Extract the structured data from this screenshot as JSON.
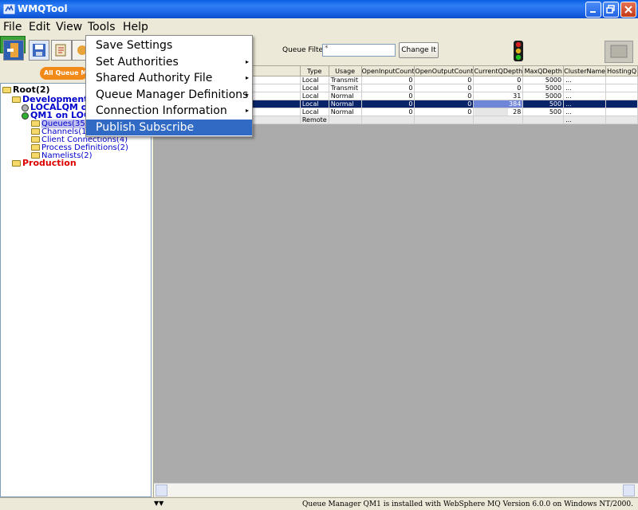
{
  "window": {
    "title": "WMQTool"
  },
  "menubar": {
    "file": "File",
    "edit": "Edit",
    "view": "View",
    "tools": "Tools",
    "help": "Help"
  },
  "tools_menu": {
    "items": [
      {
        "label": "Save Settings",
        "submenu": false
      },
      {
        "label": "Set Authorities",
        "submenu": true
      },
      {
        "label": "Shared Authority File",
        "submenu": true
      },
      {
        "label": "Queue Manager Definitions",
        "submenu": true
      },
      {
        "label": "Connection Information",
        "submenu": true
      },
      {
        "label": "Publish Subscribe",
        "submenu": false,
        "highlighted": true
      }
    ]
  },
  "toolbar": {
    "filter_label": "Queue Filter:",
    "filter_value": "*",
    "change_button": "Change It"
  },
  "tree": {
    "all_qm_button": "All Queue Ma",
    "root": "Root(2)",
    "development": "Development(2",
    "localqm": "LOCALQM on",
    "qm1": "QM1 on LOC",
    "queues": "Queues(35)",
    "channels": "Channels(13",
    "client_connections": "Client Connections(4)",
    "process_definitions": "Process Definitions(2)",
    "namelists": "Namelists(2)",
    "production": "Production"
  },
  "table": {
    "columns": [
      "Type",
      "Usage",
      "OpenInputCount",
      "OpenOutputCount",
      "CurrentQDepth",
      "MaxQDepth",
      "ClusterName",
      "HostingQ"
    ],
    "rows": [
      {
        "type": "Local",
        "usage": "Transmit",
        "in": "0",
        "out": "0",
        "depth": "0",
        "max": "5000",
        "cluster": "...",
        "hosting": ""
      },
      {
        "type": "Local",
        "usage": "Transmit",
        "in": "0",
        "out": "0",
        "depth": "0",
        "max": "5000",
        "cluster": "...",
        "hosting": ""
      },
      {
        "type": "Local",
        "usage": "Normal",
        "in": "0",
        "out": "0",
        "depth": "31",
        "max": "5000",
        "cluster": "...",
        "hosting": ""
      },
      {
        "type": "Local",
        "usage": "Normal",
        "in": "0",
        "out": "0",
        "depth": "384",
        "max": "500",
        "cluster": "...",
        "hosting": ""
      },
      {
        "type": "Local",
        "usage": "Normal",
        "in": "0",
        "out": "0",
        "depth": "28",
        "max": "500",
        "cluster": "...",
        "hosting": ""
      },
      {
        "type": "Remote",
        "usage": "",
        "in": "",
        "out": "",
        "depth": "",
        "max": "",
        "cluster": "...",
        "hosting": ""
      }
    ]
  },
  "statusbar": {
    "text": "Queue Manager QM1 is installed with WebSphere MQ Version 6.0.0 on Windows NT/2000."
  }
}
